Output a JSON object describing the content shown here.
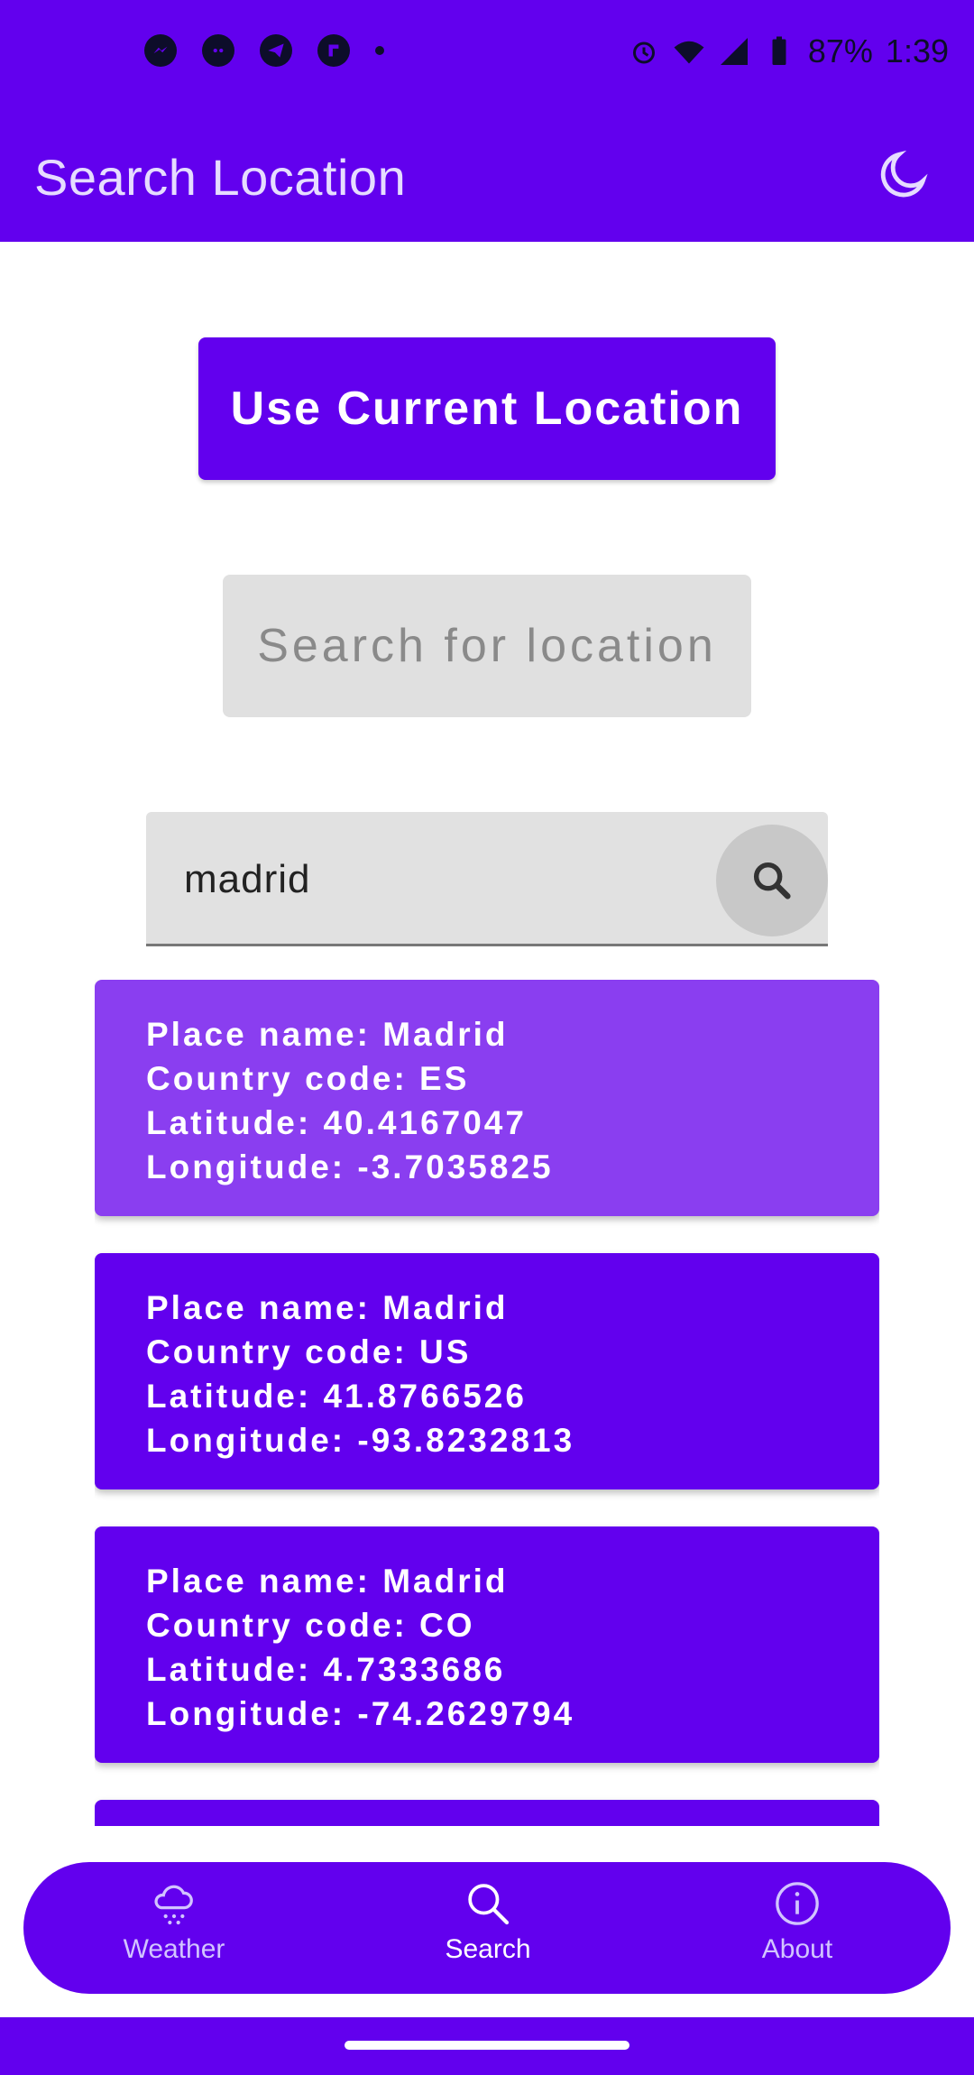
{
  "status_bar": {
    "battery": "87%",
    "time": "1:39",
    "left_icons": [
      "messenger-icon",
      "discord-icon",
      "telegram-icon",
      "flipboard-icon",
      "dot-icon"
    ],
    "right_icons": [
      "alarm-icon",
      "wifi-icon",
      "signal-icon",
      "battery-icon"
    ]
  },
  "app_bar": {
    "title": "Search Location",
    "theme_icon": "moon-icon"
  },
  "actions": {
    "current_location_label": "Use Current Location",
    "search_location_label": "Search for location"
  },
  "search": {
    "value": "madrid",
    "icon": "search-icon"
  },
  "results": [
    {
      "lines": [
        "Place name: Madrid",
        "Country code: ES",
        "Latitude: 40.4167047",
        "Longitude: -3.7035825"
      ],
      "selected": true
    },
    {
      "lines": [
        "Place name: Madrid",
        "Country code: US",
        "Latitude: 41.8766526",
        "Longitude: -93.8232813"
      ],
      "selected": false
    },
    {
      "lines": [
        "Place name: Madrid",
        "Country code: CO",
        "Latitude: 4.7333686",
        "Longitude: -74.2629794"
      ],
      "selected": false
    }
  ],
  "bottom_nav": [
    {
      "label": "Weather",
      "icon": "cloud-rain-icon",
      "active": false
    },
    {
      "label": "Search",
      "icon": "search-icon",
      "active": true
    },
    {
      "label": "About",
      "icon": "info-icon",
      "active": false
    }
  ],
  "colors": {
    "primary": "#6200ee",
    "selected_card": "#8a3ef0",
    "input_bg": "#e1e1e1"
  }
}
